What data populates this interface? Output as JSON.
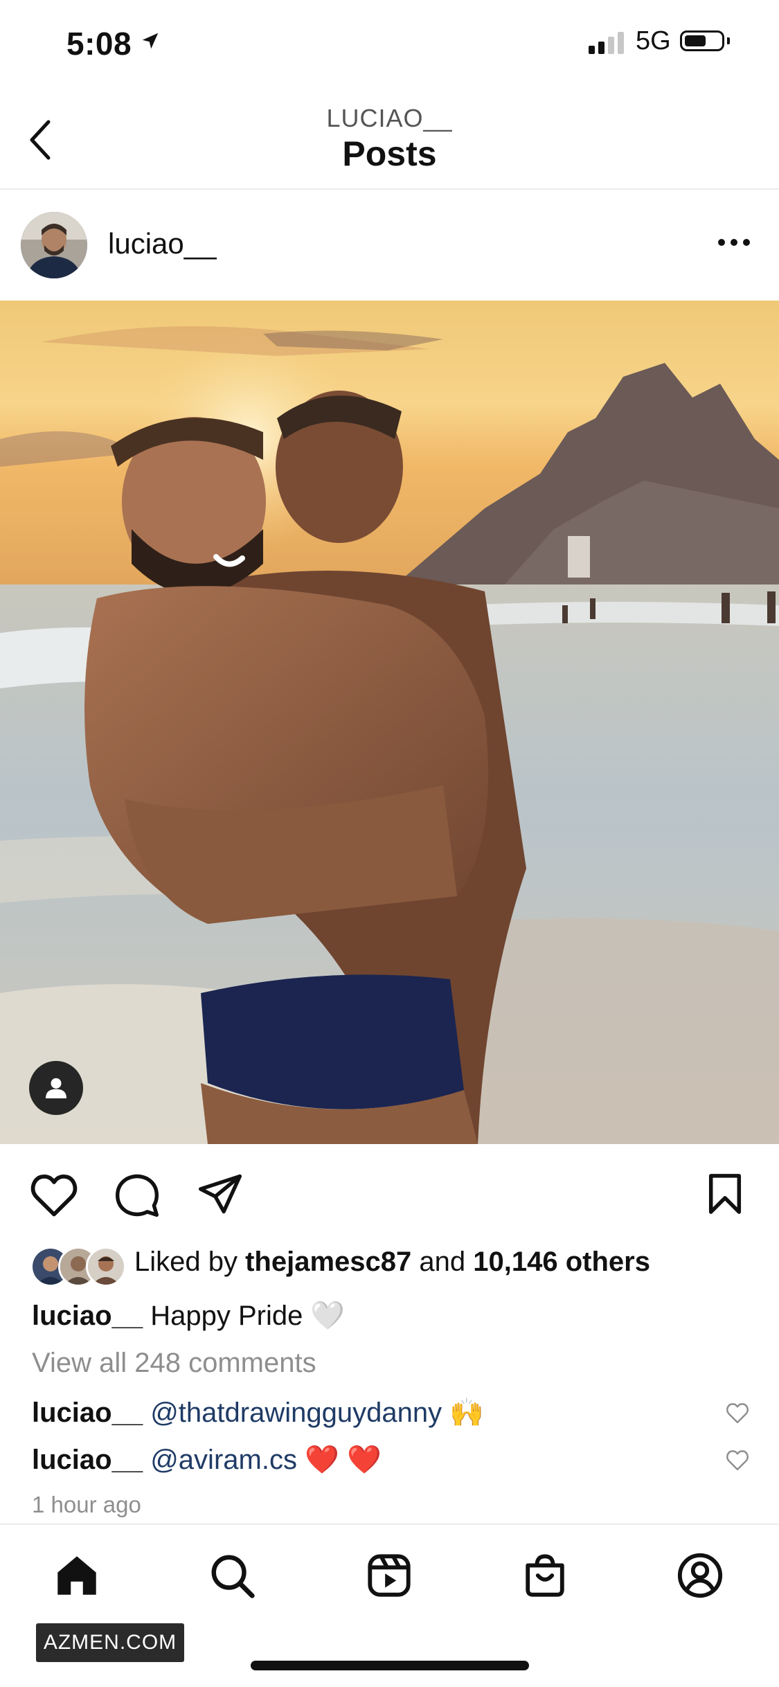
{
  "status_bar": {
    "time": "5:08",
    "network": "5G",
    "location_icon": "location-arrow-icon",
    "signal_bars_active": 2,
    "battery_level_fraction": 0.5
  },
  "header": {
    "username": "LUCIAO__",
    "title": "Posts",
    "back_icon": "chevron-left-icon"
  },
  "post": {
    "author": "luciao__",
    "more_icon": "ellipsis-icon",
    "image_alt": "photo",
    "tag_icon": "person-tag-icon",
    "actions": {
      "like_icon": "heart-outline-icon",
      "comment_icon": "comment-bubble-icon",
      "share_icon": "paper-plane-icon",
      "save_icon": "bookmark-outline-icon"
    },
    "likes": {
      "prefix": "Liked by",
      "user": "thejamesc87",
      "conjunction": "and",
      "others": "10,146 others"
    },
    "caption": {
      "user": "luciao__",
      "text": "Happy Pride 🤍"
    },
    "view_comments": "View all 248 comments",
    "comments": [
      {
        "user": "luciao__",
        "mention": "@thatdrawingguydanny",
        "emoji": "🙌"
      },
      {
        "user": "luciao__",
        "mention": "@aviram.cs",
        "emoji": "❤️ ❤️"
      }
    ],
    "timestamp": "1 hour ago"
  },
  "tab_bar": {
    "items": [
      "home-icon",
      "search-icon",
      "reels-icon",
      "shop-icon",
      "profile-icon"
    ]
  },
  "watermark": "AZMEN.COM",
  "colors": {
    "mention": "#1f3b66",
    "muted": "#8e8e8e",
    "sky_top": "#f0c877",
    "sea": "#b9c4c9"
  }
}
